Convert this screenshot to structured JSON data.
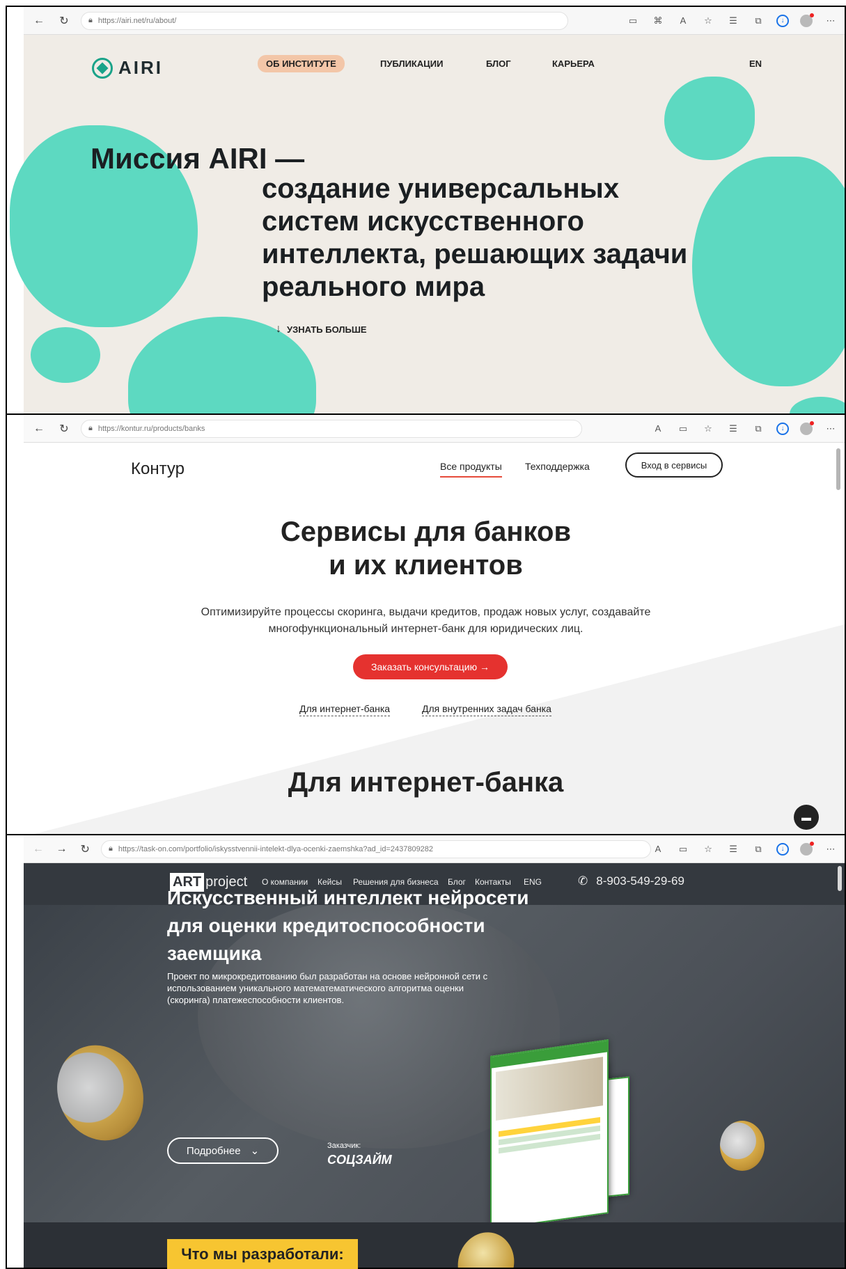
{
  "panel1": {
    "url": "https://airi.net/ru/about/",
    "logo": "AIRI",
    "nav": [
      "ОБ ИНСТИТУТЕ",
      "ПУБЛИКАЦИИ",
      "БЛОГ",
      "КАРЬЕРА"
    ],
    "lang": "EN",
    "headline_1": "Миссия AIRI —",
    "headline_2": "создание универсальных систем искусственного интеллекта, решающих задачи реального мира",
    "more": "УЗНАТЬ БОЛЬШЕ"
  },
  "panel2": {
    "url": "https://kontur.ru/products/banks",
    "logo": "Контур",
    "nav": [
      "Все продукты",
      "Техподдержка"
    ],
    "login_button": "Вход в сервисы",
    "title_line1": "Сервисы для банков",
    "title_line2": "и их клиентов",
    "subtitle": "Оптимизируйте процессы скоринга, выдачи кредитов, продаж новых услуг, создавайте многофункциональный интернет-банк для юридических лиц.",
    "cta": "Заказать консультацию →",
    "links": [
      "Для интернет-банка",
      "Для внутренних задач банка"
    ],
    "section_title": "Для интернет-банка"
  },
  "panel3": {
    "url": "https://task-on.com/portfolio/iskysstvennii-intelekt-dlya-ocenki-zaemshka?ad_id=2437809282",
    "logo_art": "ART",
    "logo_project": "project",
    "nav": [
      "О компании",
      "Кейсы",
      "Решения для бизнеса",
      "Блог",
      "Контакты",
      "ENG"
    ],
    "phone": "8-903-549-29-69",
    "headline": "Искусственный интеллект нейросети для оценки кредитоспособности заемщика",
    "description": "Проект по микрокредитованию был разработан на основе нейронной сети с использованием уникального математематического алгоритма оценки (скоринга) платежеспособности клиентов.",
    "more_button": "Подробнее",
    "client_label": "Заказчик:",
    "client_name": "СОЦЗАЙМ",
    "badge": "Что мы разработали:"
  },
  "colors": {
    "airi_teal": "#5dd9c1",
    "kontur_red": "#e5322f",
    "art_yellow": "#f7c531"
  }
}
